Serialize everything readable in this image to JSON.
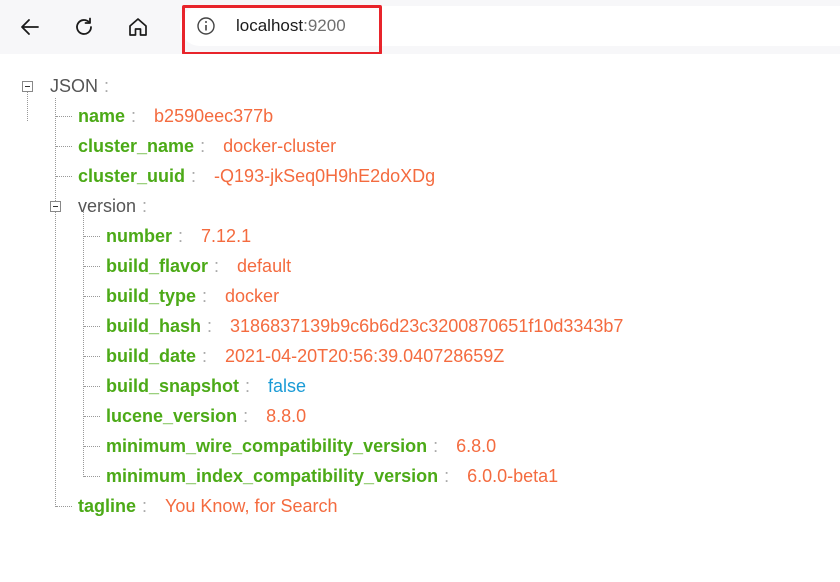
{
  "browser": {
    "back_icon": "arrow-left-icon",
    "reload_icon": "reload-icon",
    "home_icon": "home-icon",
    "site_info_icon": "info-icon",
    "url_host": "localhost",
    "url_port": ":9200",
    "highlight_color": "#e8242b"
  },
  "tree": {
    "root_label": "JSON",
    "name_key": "name",
    "name_value": "b2590eec377b",
    "cluster_name_key": "cluster_name",
    "cluster_name_value": "docker-cluster",
    "cluster_uuid_key": "cluster_uuid",
    "cluster_uuid_value": "-Q193-jkSeq0H9hE2doXDg",
    "version_label": "version",
    "version": {
      "number_key": "number",
      "number_value": "7.12.1",
      "build_flavor_key": "build_flavor",
      "build_flavor_value": "default",
      "build_type_key": "build_type",
      "build_type_value": "docker",
      "build_hash_key": "build_hash",
      "build_hash_value": "3186837139b9c6b6d23c3200870651f10d3343b7",
      "build_date_key": "build_date",
      "build_date_value": "2021-04-20T20:56:39.040728659Z",
      "build_snapshot_key": "build_snapshot",
      "build_snapshot_value": "false",
      "lucene_version_key": "lucene_version",
      "lucene_version_value": "8.8.0",
      "min_wire_key": "minimum_wire_compatibility_version",
      "min_wire_value": "6.8.0",
      "min_index_key": "minimum_index_compatibility_version",
      "min_index_value": "6.0.0-beta1"
    },
    "tagline_key": "tagline",
    "tagline_value": "You Know, for Search",
    "colors": {
      "key": "#4caa17",
      "string": "#f46b3f",
      "boolean": "#1a9bd6"
    }
  }
}
